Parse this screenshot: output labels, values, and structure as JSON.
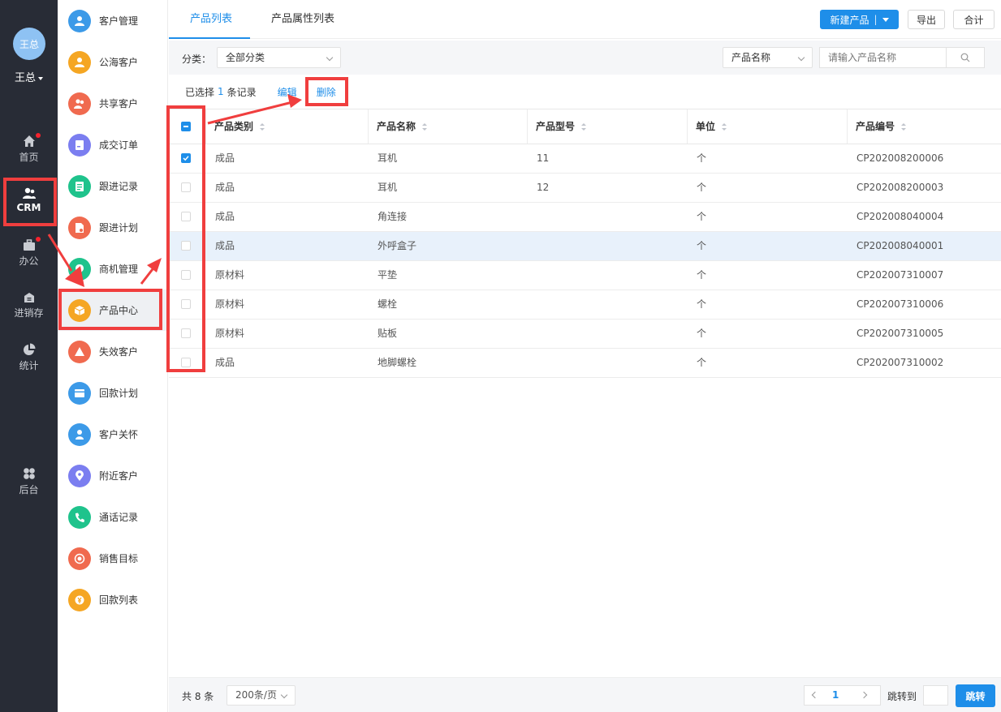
{
  "user": {
    "avatar_text": "王总",
    "name": "王总"
  },
  "rail": [
    {
      "label": "首页",
      "icon": "home-icon",
      "badge": true
    },
    {
      "label": "CRM",
      "icon": "users-icon",
      "badge": false
    },
    {
      "label": "办公",
      "icon": "briefcase-icon",
      "badge": true
    },
    {
      "label": "进销存",
      "icon": "warehouse-icon",
      "badge": false
    },
    {
      "label": "统计",
      "icon": "pie-chart-icon",
      "badge": false
    },
    {
      "label": "后台",
      "icon": "grid-icon",
      "badge": false
    }
  ],
  "submenu": [
    {
      "label": "客户管理",
      "icon": "customers-icon",
      "color": "#3c9ae8"
    },
    {
      "label": "公海客户",
      "icon": "person-icon",
      "color": "#f5a623"
    },
    {
      "label": "共享客户",
      "icon": "share-users-icon",
      "color": "#f06a4f"
    },
    {
      "label": "成交订单",
      "icon": "order-icon",
      "color": "#7b7ef0"
    },
    {
      "label": "跟进记录",
      "icon": "notes-icon",
      "color": "#1fc38c"
    },
    {
      "label": "跟进计划",
      "icon": "plan-icon",
      "color": "#f06a4f"
    },
    {
      "label": "商机管理",
      "icon": "opportunity-icon",
      "color": "#1fc38c"
    },
    {
      "label": "产品中心",
      "icon": "product-box-icon",
      "color": "#f5a623"
    },
    {
      "label": "失效客户",
      "icon": "warning-icon",
      "color": "#f06a4f"
    },
    {
      "label": "回款计划",
      "icon": "payment-plan-icon",
      "color": "#3c9ae8"
    },
    {
      "label": "客户关怀",
      "icon": "care-icon",
      "color": "#3c9ae8"
    },
    {
      "label": "附近客户",
      "icon": "location-icon",
      "color": "#7b7ef0"
    },
    {
      "label": "通话记录",
      "icon": "phone-icon",
      "color": "#1fc38c"
    },
    {
      "label": "销售目标",
      "icon": "target-icon",
      "color": "#f06a4f"
    },
    {
      "label": "回款列表",
      "icon": "payment-list-icon",
      "color": "#f5a623"
    }
  ],
  "tabs": [
    "产品列表",
    "产品属性列表"
  ],
  "actions": {
    "new_product": "新建产品",
    "export": "导出",
    "total": "合计"
  },
  "filter": {
    "category_label": "分类：",
    "category_value": "全部分类",
    "field_select": "产品名称",
    "search_placeholder": "请输入产品名称"
  },
  "selection": {
    "prefix": "已选择",
    "count": "1",
    "suffix": "条记录",
    "edit": "编辑",
    "delete": "删除"
  },
  "columns": [
    "产品类别",
    "产品名称",
    "产品型号",
    "单位",
    "产品编号"
  ],
  "rows": [
    {
      "checked": true,
      "category": "成品",
      "name": "耳机",
      "model": "11",
      "unit": "个",
      "code": "CP202008200006"
    },
    {
      "checked": false,
      "category": "成品",
      "name": "耳机",
      "model": "12",
      "unit": "个",
      "code": "CP202008200003"
    },
    {
      "checked": false,
      "category": "成品",
      "name": "角连接",
      "model": "",
      "unit": "个",
      "code": "CP202008040004"
    },
    {
      "checked": false,
      "category": "成品",
      "name": "外呼盒子",
      "model": "",
      "unit": "个",
      "code": "CP202008040001"
    },
    {
      "checked": false,
      "category": "原材料",
      "name": "平垫",
      "model": "",
      "unit": "个",
      "code": "CP202007310007"
    },
    {
      "checked": false,
      "category": "原材料",
      "name": "螺栓",
      "model": "",
      "unit": "个",
      "code": "CP202007310006"
    },
    {
      "checked": false,
      "category": "原材料",
      "name": "贴板",
      "model": "",
      "unit": "个",
      "code": "CP202007310005"
    },
    {
      "checked": false,
      "category": "成品",
      "name": "地脚螺栓",
      "model": "",
      "unit": "个",
      "code": "CP202007310002"
    }
  ],
  "footer": {
    "total": "共 8 条",
    "page_size": "200条/页",
    "current_page": "1",
    "jump_label": "跳转到",
    "jump_button": "跳转"
  },
  "colors": {
    "accent": "#1e8ee9",
    "annotation": "#f03e3e",
    "rail_bg": "#282c36"
  }
}
